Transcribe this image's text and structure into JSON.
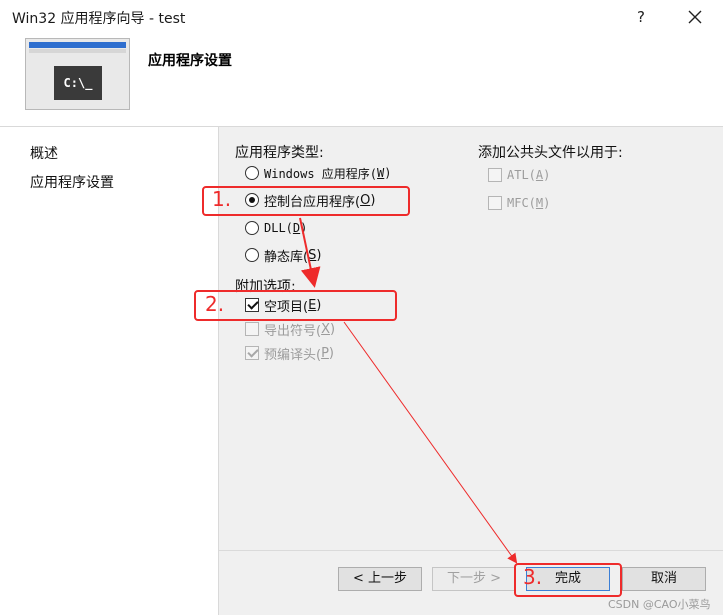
{
  "window": {
    "title": "Win32 应用程序向导 - test",
    "help_glyph": "?",
    "close_icon": "close-icon"
  },
  "header": {
    "image_text": "C:\\_",
    "title": "应用程序设置"
  },
  "nav": {
    "items": [
      {
        "label": "概述"
      },
      {
        "label": "应用程序设置"
      }
    ]
  },
  "app_type": {
    "label": "应用程序类型:",
    "options": [
      {
        "label": "Windows 应用程序(",
        "key": "W",
        "suffix": ")",
        "selected": false
      },
      {
        "label": "控制台应用程序(",
        "key": "O",
        "suffix": ")",
        "selected": true
      },
      {
        "label": "DLL(",
        "key": "D",
        "suffix": ")",
        "selected": false
      },
      {
        "label": "静态库(",
        "key": "S",
        "suffix": ")",
        "selected": false
      }
    ]
  },
  "additional": {
    "label": "附加选项:",
    "options": [
      {
        "label": "空项目(",
        "key": "E",
        "suffix": ")",
        "checked": true,
        "enabled": true
      },
      {
        "label": "导出符号(",
        "key": "X",
        "suffix": ")",
        "checked": false,
        "enabled": false
      },
      {
        "label": "预编译头(",
        "key": "P",
        "suffix": ")",
        "checked": true,
        "enabled": false
      }
    ]
  },
  "common_headers": {
    "label": "添加公共头文件以用于:",
    "options": [
      {
        "label": "ATL(",
        "key": "A",
        "suffix": ")",
        "checked": false,
        "enabled": false
      },
      {
        "label": "MFC(",
        "key": "M",
        "suffix": ")",
        "checked": false,
        "enabled": false
      }
    ]
  },
  "footer": {
    "prev_label": "< 上一步",
    "next_label": "下一步 >",
    "finish_label": "完成",
    "cancel_label": "取消"
  },
  "annotations": {
    "step1": "1.",
    "step2": "2.",
    "step3": "3.",
    "color": "#ee2b2b"
  },
  "watermark": "CSDN @CAO小菜鸟"
}
